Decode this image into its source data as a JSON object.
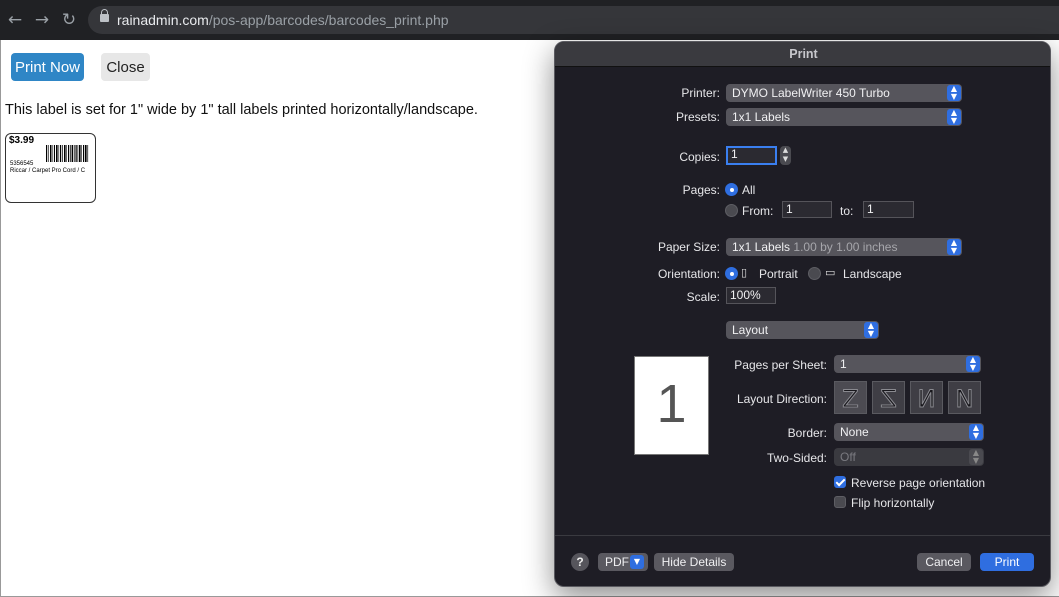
{
  "browser": {
    "url_domain": "rainadmin.com",
    "url_path": "/pos-app/barcodes/barcodes_print.php",
    "back_icon": "←",
    "forward_icon": "→",
    "reload_icon": "↻"
  },
  "page": {
    "print_now_label": "Print Now",
    "close_label": "Close",
    "description": "This label is set for 1\" wide by 1\" tall labels printed horizontally/landscape.",
    "label": {
      "price": "$3.99",
      "sku": "5356545",
      "name": "Riccar / Carpet Pro Cord / C"
    }
  },
  "print_dialog": {
    "title": "Print",
    "printer_label": "Printer:",
    "printer_value": "DYMO LabelWriter 450 Turbo",
    "presets_label": "Presets:",
    "presets_value": "1x1 Labels",
    "copies_label": "Copies:",
    "copies_value": "1",
    "pages_label": "Pages:",
    "pages_all": "All",
    "pages_from_label": "From:",
    "pages_from_value": "1",
    "pages_to_label": "to:",
    "pages_to_value": "1",
    "paper_size_label": "Paper Size:",
    "paper_size_value": "1x1 Labels",
    "paper_size_detail": "1.00 by 1.00 inches",
    "orientation_label": "Orientation:",
    "orientation_portrait": "Portrait",
    "orientation_landscape": "Landscape",
    "scale_label": "Scale:",
    "scale_value": "100%",
    "section_value": "Layout",
    "preview_page": "1",
    "pages_per_sheet_label": "Pages per Sheet:",
    "pages_per_sheet_value": "1",
    "layout_direction_label": "Layout Direction:",
    "layout_direction_options": [
      "Z",
      "Z",
      "N",
      "N"
    ],
    "border_label": "Border:",
    "border_value": "None",
    "two_sided_label": "Two-Sided:",
    "two_sided_value": "Off",
    "reverse_orientation_label": "Reverse page orientation",
    "reverse_orientation_checked": true,
    "flip_horizontally_label": "Flip horizontally",
    "flip_horizontally_checked": false,
    "help_label": "?",
    "pdf_label": "PDF",
    "hide_details_label": "Hide Details",
    "cancel_label": "Cancel",
    "print_label": "Print"
  },
  "colors": {
    "print_now_button": "#2f86c6",
    "dialog_background": "#1e1d25",
    "accent_blue": "#2f6ee0"
  }
}
